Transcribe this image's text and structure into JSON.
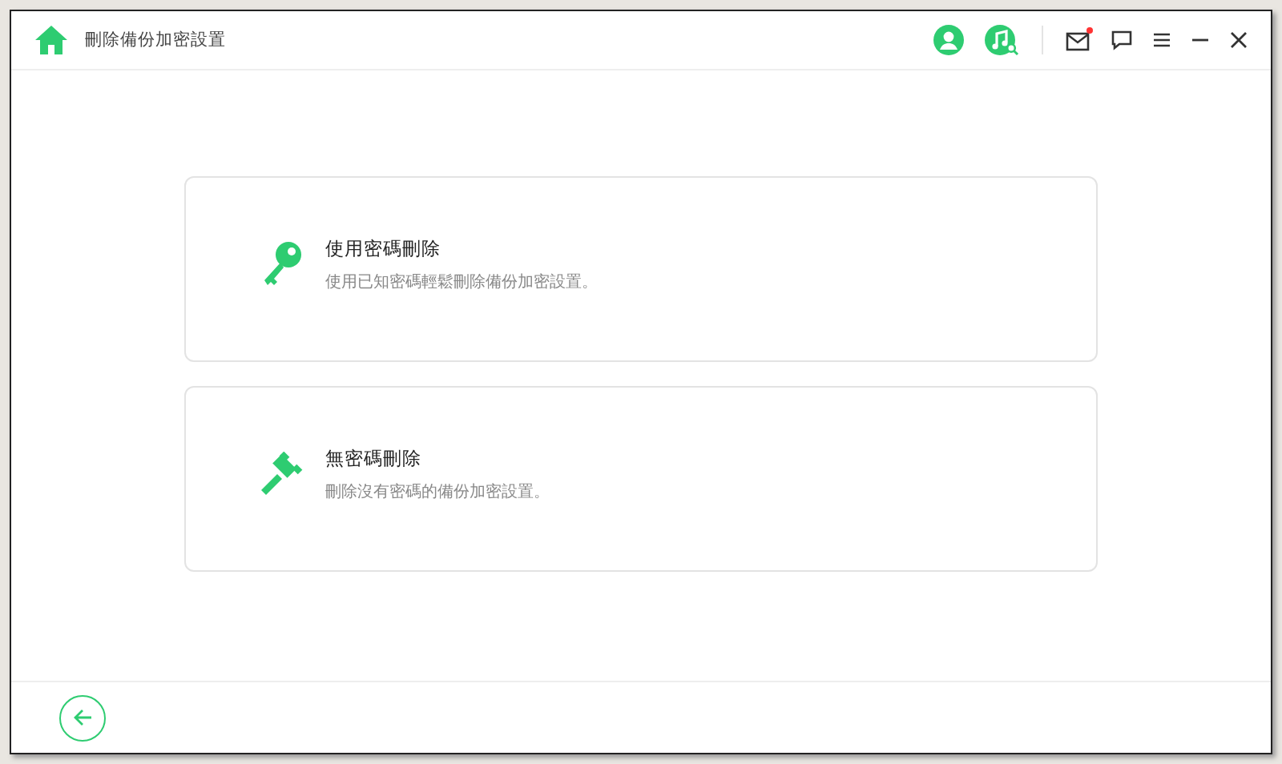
{
  "window": {
    "title": "刪除備份加密設置"
  },
  "toolbar": {
    "mail_unread": true
  },
  "options": [
    {
      "kind": "key",
      "title": "使用密碼刪除",
      "description": "使用已知密碼輕鬆刪除備份加密設置。"
    },
    {
      "kind": "gavel",
      "title": "無密碼刪除",
      "description": "刪除沒有密碼的備份加密設置。"
    }
  ]
}
